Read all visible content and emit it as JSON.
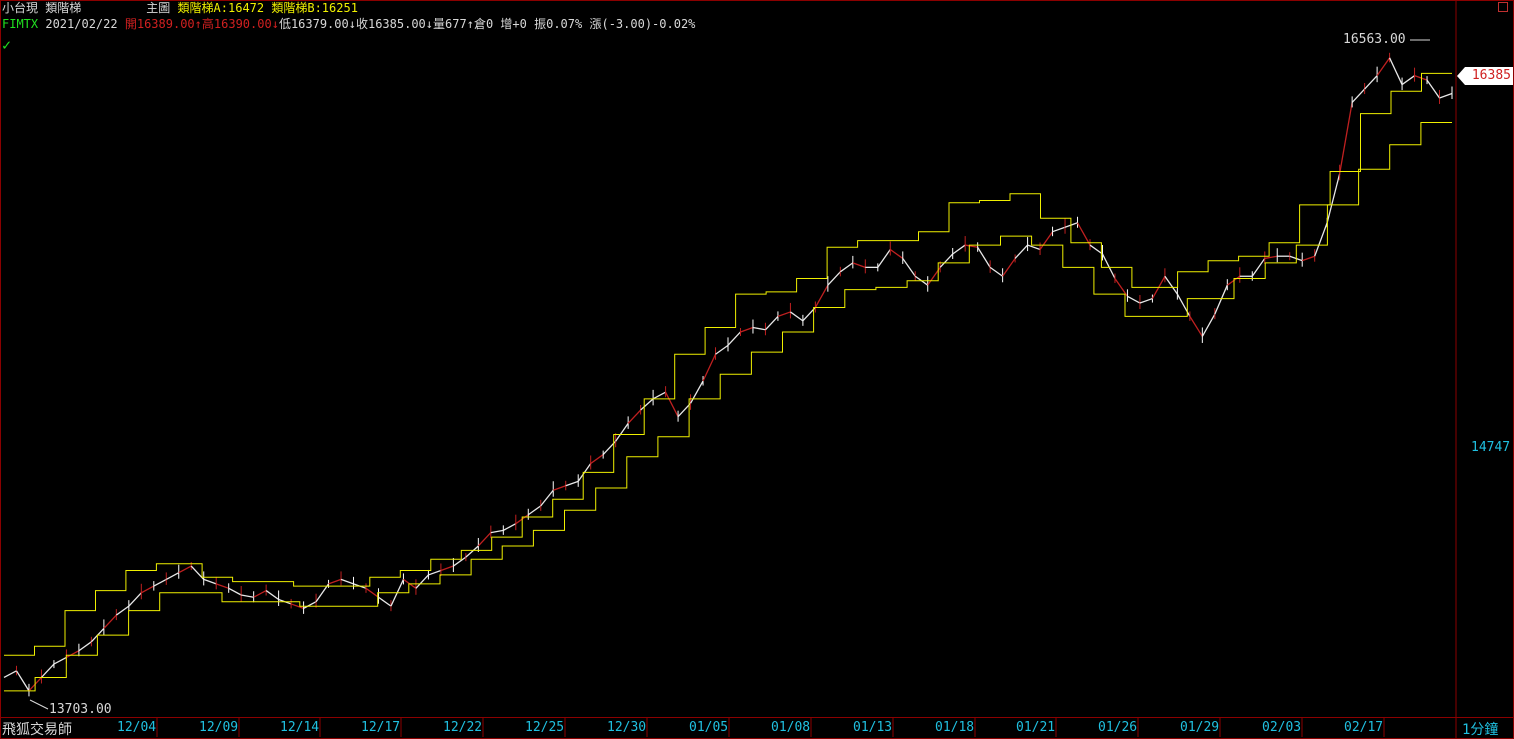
{
  "header": {
    "symbol_name": "小台現",
    "indicator_name": "類階梯",
    "main_label": "主圖",
    "ind_a": "類階梯A:16472",
    "ind_b": "類階梯B:16251",
    "code": "FIMTX",
    "date": "2021/02/22",
    "open": "開16389.00",
    "high": "高16390.00",
    "low": "低16379.00",
    "close": "收16385.00",
    "volume": "量677",
    "oi": "倉0",
    "oi_change": "增+0",
    "amplitude": "振0.07%",
    "change": "漲(-3.00)-0.02%"
  },
  "footer": {
    "brand": "飛狐交易師",
    "period": "1分鐘"
  },
  "colors": {
    "background": "#000000",
    "ladder": "#f0f000",
    "axis_text": "#20c0e0",
    "frame": "#8b0000"
  },
  "chart_data": {
    "type": "line",
    "title": "",
    "x_ticks": [
      "12/04",
      "12/09",
      "12/14",
      "12/17",
      "12/22",
      "12/25",
      "12/30",
      "01/05",
      "01/08",
      "01/13",
      "01/18",
      "01/21",
      "01/26",
      "01/29",
      "02/03",
      "02/17"
    ],
    "y_ticks": [
      "14747"
    ],
    "last_price_label": "16385",
    "high_annotation": "16563.00",
    "low_annotation": "13703.00",
    "ylim": [
      13650,
      16620
    ],
    "series": [
      {
        "values": [
          13760,
          13790,
          13700,
          13760,
          13820,
          13850,
          13880,
          13920,
          13980,
          14040,
          14080,
          14140,
          14170,
          14200,
          14230,
          14260,
          14200,
          14180,
          14160,
          14130,
          14120,
          14150,
          14110,
          14090,
          14070,
          14100,
          14180,
          14200,
          14180,
          14160,
          14120,
          14080,
          14200,
          14160,
          14220,
          14240,
          14260,
          14300,
          14350,
          14410,
          14420,
          14450,
          14490,
          14530,
          14600,
          14620,
          14640,
          14720,
          14760,
          14820,
          14900,
          14960,
          15010,
          15040,
          14930,
          14990,
          15090,
          15210,
          15250,
          15310,
          15330,
          15320,
          15380,
          15400,
          15360,
          15420,
          15520,
          15580,
          15620,
          15600,
          15600,
          15680,
          15640,
          15560,
          15520,
          15600,
          15660,
          15700,
          15690,
          15600,
          15560,
          15640,
          15700,
          15680,
          15760,
          15780,
          15800,
          15700,
          15660,
          15550,
          15470,
          15440,
          15460,
          15560,
          15480,
          15380,
          15290,
          15390,
          15520,
          15560,
          15560,
          15640,
          15650,
          15650,
          15630,
          15650,
          15800,
          16020,
          16340,
          16400,
          16460,
          16540,
          16420,
          16460,
          16440,
          16360,
          16380
        ]
      },
      {
        "values": [
          13860,
          13860,
          13900,
          13900,
          14060,
          14060,
          14150,
          14150,
          14240,
          14240,
          14270,
          14270,
          14270,
          14210,
          14210,
          14190,
          14190,
          14190,
          14190,
          14170,
          14170,
          14170,
          14170,
          14170,
          14210,
          14210,
          14240,
          14240,
          14290,
          14290,
          14330,
          14330,
          14390,
          14390,
          14480,
          14480,
          14560,
          14560,
          14680,
          14680,
          14850,
          14850,
          15010,
          15010,
          15210,
          15210,
          15330,
          15330,
          15480,
          15480,
          15490,
          15490,
          15550,
          15550,
          15690,
          15690,
          15720,
          15720,
          15720,
          15720,
          15760,
          15760,
          15890,
          15890,
          15900,
          15900,
          15930,
          15930,
          15820,
          15820,
          15710,
          15710,
          15600,
          15600,
          15510,
          15510,
          15510,
          15580,
          15580,
          15630,
          15630,
          15650,
          15650,
          15710,
          15710,
          15880,
          15880,
          16030,
          16030,
          16290,
          16290,
          16390,
          16390,
          16470,
          16470
        ]
      },
      {
        "values": [
          13700,
          13700,
          13760,
          13760,
          13860,
          13860,
          13950,
          13950,
          14060,
          14060,
          14140,
          14140,
          14140,
          14140,
          14100,
          14100,
          14100,
          14100,
          14100,
          14080,
          14080,
          14080,
          14080,
          14080,
          14140,
          14140,
          14180,
          14180,
          14220,
          14220,
          14290,
          14290,
          14350,
          14350,
          14420,
          14420,
          14510,
          14510,
          14610,
          14610,
          14750,
          14750,
          14840,
          14840,
          15010,
          15010,
          15120,
          15120,
          15220,
          15220,
          15310,
          15310,
          15420,
          15420,
          15500,
          15500,
          15510,
          15510,
          15540,
          15540,
          15620,
          15620,
          15700,
          15700,
          15740,
          15740,
          15700,
          15700,
          15600,
          15600,
          15480,
          15480,
          15380,
          15380,
          15380,
          15380,
          15460,
          15460,
          15460,
          15550,
          15550,
          15620,
          15620,
          15700,
          15700,
          15880,
          15880,
          16040,
          16040,
          16150,
          16150,
          16250,
          16250
        ]
      }
    ]
  }
}
